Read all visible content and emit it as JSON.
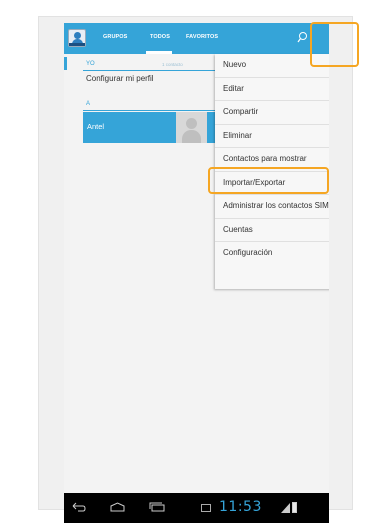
{
  "tabs": [
    {
      "label": "GRUPOS"
    },
    {
      "label": "TODOS"
    },
    {
      "label": "FAVORITOS"
    }
  ],
  "list": {
    "section_me": "YO",
    "contact_count": "1 contacto",
    "profile_label": "Configurar mi perfil",
    "section_letter": "A",
    "contacts": [
      {
        "name": "Antel"
      }
    ]
  },
  "menu": {
    "items": [
      {
        "label": "Nuevo"
      },
      {
        "label": "Editar"
      },
      {
        "label": "Compartir"
      },
      {
        "label": "Eliminar"
      },
      {
        "label": "Contactos para mostrar"
      },
      {
        "label": "Importar/Exportar"
      },
      {
        "label": "Administrar los contactos SIM"
      },
      {
        "label": "Cuentas"
      },
      {
        "label": "Configuración"
      }
    ]
  },
  "status": {
    "time": "11:53"
  },
  "icons": {
    "app": "contacts-app-icon",
    "search": "search-icon",
    "overflow": "overflow-menu-icon",
    "back": "back-icon",
    "home": "home-icon",
    "recents": "recent-apps-icon"
  },
  "colors": {
    "accent": "#35a4d8",
    "highlight": "#f5a623"
  }
}
